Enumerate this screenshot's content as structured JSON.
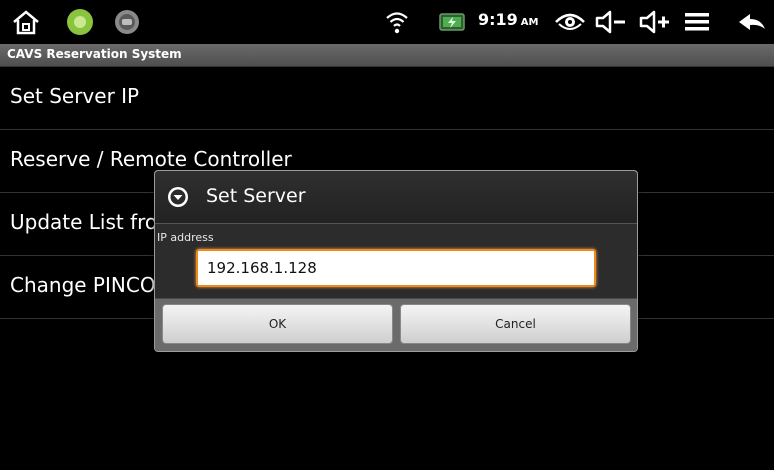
{
  "status_bar": {
    "time": "9:19",
    "ampm": "AM",
    "icons": [
      "home-icon",
      "green-app-icon",
      "gray-app-icon",
      "wifi-icon",
      "battery-charging-icon",
      "eye-icon",
      "volume-down-icon",
      "volume-up-icon",
      "menu-icon",
      "back-icon"
    ]
  },
  "app": {
    "title": "CAVS Reservation System"
  },
  "menu": {
    "items": [
      {
        "label": "Set Server IP"
      },
      {
        "label": "Reserve / Remote Controller"
      },
      {
        "label": "Update List from SD"
      },
      {
        "label": "Change PINCODE"
      }
    ]
  },
  "dialog": {
    "title": "Set Server",
    "field_label": "IP address",
    "ip_value": "192.168.1.128",
    "ok_label": "OK",
    "cancel_label": "Cancel",
    "colors": {
      "focus_border": "#f08a1c"
    }
  }
}
